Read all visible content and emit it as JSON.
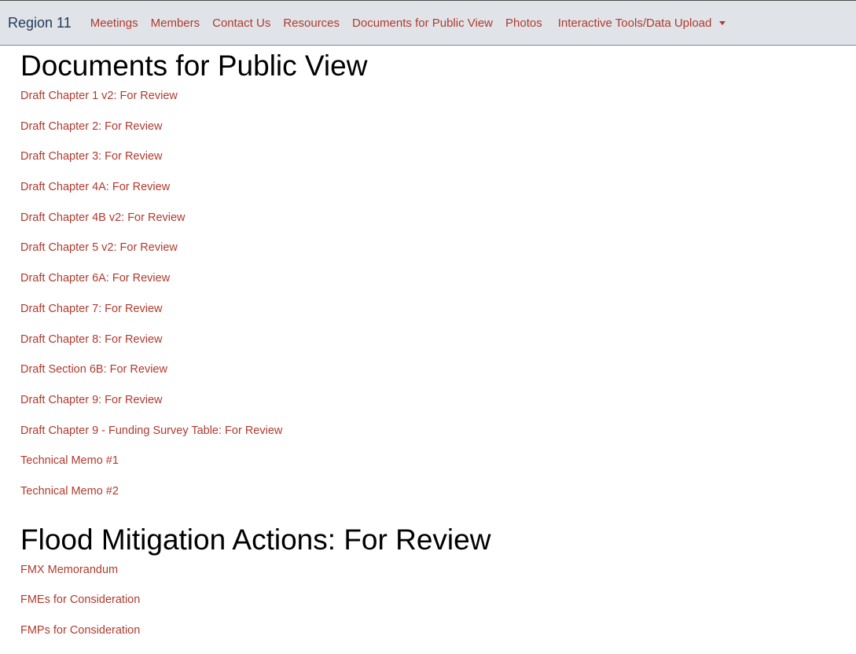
{
  "nav": {
    "brand": "Region 11",
    "links": [
      "Meetings",
      "Members",
      "Contact Us",
      "Resources",
      "Documents for Public View",
      "Photos"
    ],
    "dropdown": "Interactive Tools/Data Upload"
  },
  "sections": [
    {
      "heading": "Documents for Public View",
      "items": [
        "Draft Chapter 1 v2: For Review",
        "Draft Chapter 2: For Review",
        "Draft Chapter 3: For Review",
        "Draft Chapter 4A: For Review",
        "Draft Chapter 4B v2: For Review",
        "Draft Chapter 5 v2: For Review",
        "Draft Chapter 6A: For Review",
        "Draft Chapter 7: For Review",
        "Draft Chapter 8: For Review",
        "Draft Section 6B: For Review",
        "Draft Chapter 9: For Review",
        "Draft Chapter 9 - Funding Survey Table: For Review",
        "Technical Memo #1",
        "Technical Memo #2"
      ]
    },
    {
      "heading": "Flood Mitigation Actions: For Review",
      "items": [
        "FMX Memorandum",
        "FMEs for Consideration",
        "FMPs for Consideration"
      ]
    }
  ],
  "colors": {
    "link": "#b03a2e",
    "brand": "#1f3a5a",
    "navbar_bg": "#e0e4e8"
  }
}
